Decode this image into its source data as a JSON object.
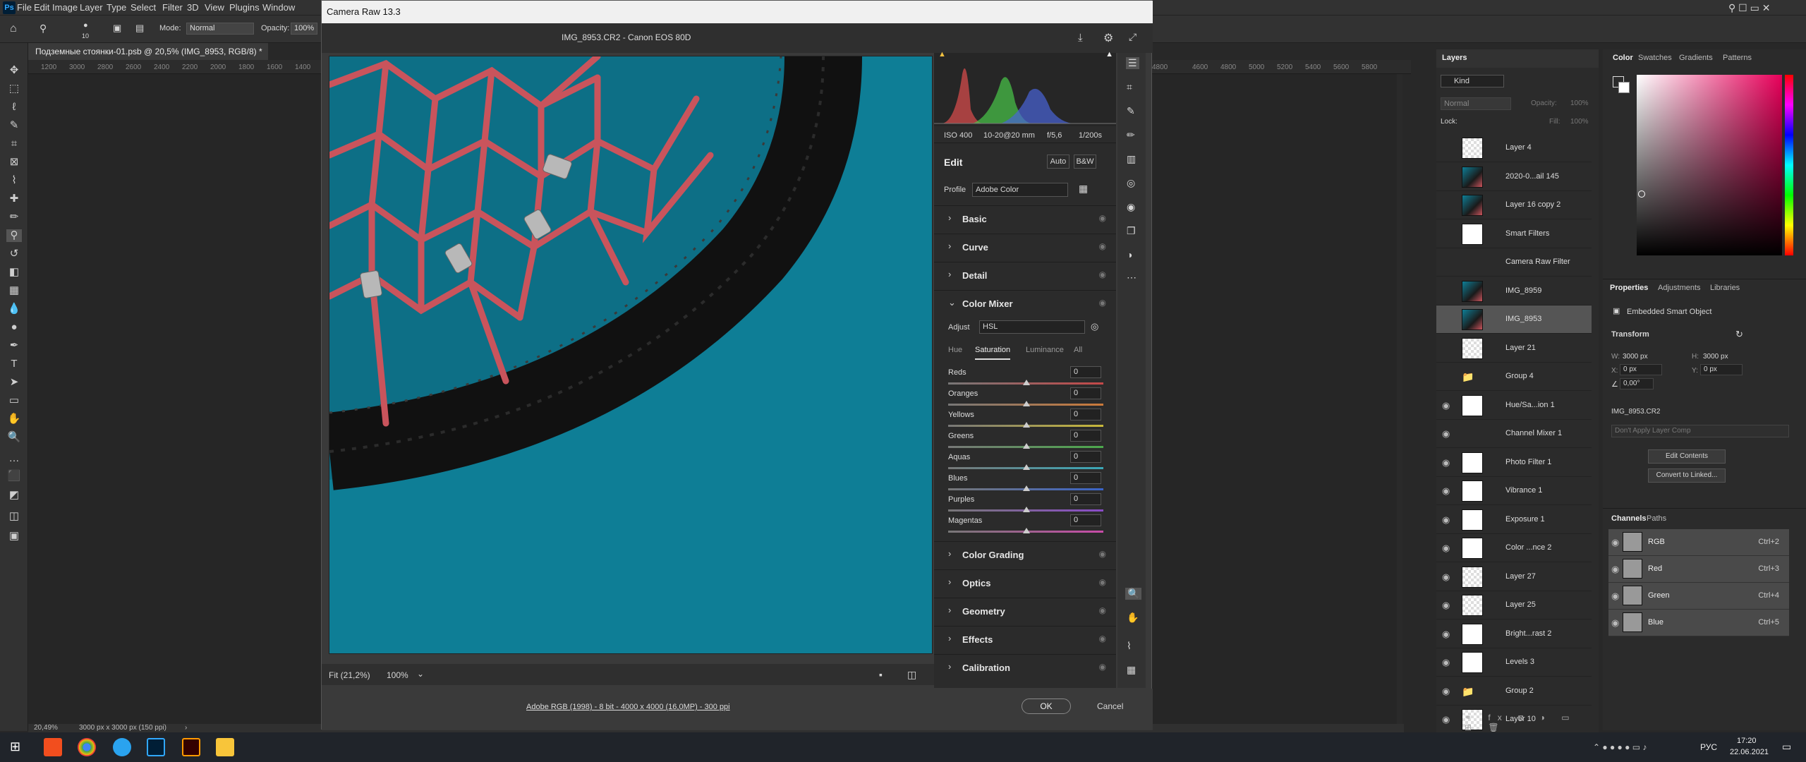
{
  "menu": [
    "File",
    "Edit",
    "Image",
    "Layer",
    "Type",
    "Select",
    "Filter",
    "3D",
    "View",
    "Plugins",
    "Window"
  ],
  "options": {
    "mode_label": "Mode:",
    "mode_value": "Normal",
    "opacity_label": "Opacity:",
    "opacity_value": "100%",
    "brush_size": "10"
  },
  "doc_tab": {
    "title": "Подземные стоянки-01.psb @ 20,5% (IMG_8953, RGB/8) *",
    "close": "×"
  },
  "ruler_left": [
    "1200",
    "3000",
    "2800",
    "2600",
    "2400",
    "2200",
    "2000",
    "1800",
    "1600",
    "1400"
  ],
  "ruler_right": [
    "4800",
    "4600",
    "4800",
    "5000",
    "5200",
    "5400",
    "5600",
    "5800"
  ],
  "status": {
    "zoom": "20,49%",
    "size": "3000 px x 3000 px (150 ppi)"
  },
  "camera_raw": {
    "window_title": "Camera Raw 13.3",
    "file_info": "IMG_8953.CR2  -  Canon EOS 80D",
    "exif": {
      "iso": "ISO 400",
      "lens": "10-20@20 mm",
      "aperture": "f/5,6",
      "shutter": "1/200s"
    },
    "edit_label": "Edit",
    "auto_label": "Auto",
    "bw_label": "B&W",
    "profile_label": "Profile",
    "profile_value": "Adobe Color",
    "sections_top": [
      "Basic",
      "Curve",
      "Detail"
    ],
    "color_mixer": {
      "title": "Color Mixer",
      "adjust_label": "Adjust",
      "adjust_value": "HSL",
      "tabs": [
        "Hue",
        "Saturation",
        "Luminance",
        "All"
      ],
      "active_tab": "Saturation",
      "sliders": [
        {
          "name": "Reds",
          "value": "0",
          "color": "#c44848"
        },
        {
          "name": "Oranges",
          "value": "0",
          "color": "#cc7a3a"
        },
        {
          "name": "Yellows",
          "value": "0",
          "color": "#c8b83a"
        },
        {
          "name": "Greens",
          "value": "0",
          "color": "#4ca84c"
        },
        {
          "name": "Aquas",
          "value": "0",
          "color": "#3aa8b8"
        },
        {
          "name": "Blues",
          "value": "0",
          "color": "#3a64c8"
        },
        {
          "name": "Purples",
          "value": "0",
          "color": "#8a4cc8"
        },
        {
          "name": "Magentas",
          "value": "0",
          "color": "#c84ca8"
        }
      ]
    },
    "sections_bottom": [
      "Color Grading",
      "Optics",
      "Geometry",
      "Effects",
      "Calibration"
    ],
    "fit_label": "Fit (21,2%)",
    "zoom_value": "100%",
    "color_info": "Adobe RGB (1998) - 8 bit - 4000 x 4000 (16,0MP) - 300 ppi",
    "ok_label": "OK",
    "cancel_label": "Cancel"
  },
  "layers": {
    "tabs": [
      "Layers"
    ],
    "kind_label": "Kind",
    "blend_mode": "Normal",
    "opacity_label": "Opacity:",
    "opacity_value": "100%",
    "lock_label": "Lock:",
    "fill_label": "Fill:",
    "fill_value": "100%",
    "rows": [
      {
        "name": "Layer 4",
        "thumb": "checker",
        "selected": false
      },
      {
        "name": "2020-0...ail 145",
        "thumb": "photo",
        "selected": false
      },
      {
        "name": "Layer 16 copy 2",
        "thumb": "photo",
        "selected": false
      },
      {
        "name": "Smart Filters",
        "thumb": "white",
        "selected": false
      },
      {
        "name": "Camera Raw Filter",
        "thumb": "none",
        "selected": false
      },
      {
        "name": "IMG_8959",
        "thumb": "photo",
        "selected": false
      },
      {
        "name": "IMG_8953",
        "thumb": "photo",
        "selected": true
      },
      {
        "name": "Layer 21",
        "thumb": "checker",
        "selected": false
      },
      {
        "name": "Group 4",
        "thumb": "folder",
        "selected": false
      },
      {
        "name": "Hue/Sa...ion 1",
        "thumb": "white",
        "selected": false
      },
      {
        "name": "Channel Mixer 1",
        "thumb": "none",
        "selected": false
      },
      {
        "name": "Photo Filter 1",
        "thumb": "white",
        "selected": false
      },
      {
        "name": "Vibrance 1",
        "thumb": "white",
        "selected": false
      },
      {
        "name": "Exposure 1",
        "thumb": "white",
        "selected": false
      },
      {
        "name": "Color ...nce 2",
        "thumb": "white",
        "selected": false
      },
      {
        "name": "Layer 27",
        "thumb": "checker",
        "selected": false
      },
      {
        "name": "Layer 25",
        "thumb": "checker",
        "selected": false
      },
      {
        "name": "Bright...rast 2",
        "thumb": "white",
        "selected": false
      },
      {
        "name": "Levels 3",
        "thumb": "white",
        "selected": false
      },
      {
        "name": "Group 2",
        "thumb": "folder",
        "selected": false
      },
      {
        "name": "Layer 10",
        "thumb": "checker",
        "selected": false
      }
    ]
  },
  "color_panel": {
    "tabs": [
      "Color",
      "Swatches",
      "Gradients",
      "Patterns"
    ]
  },
  "properties": {
    "tabs": [
      "Properties",
      "Adjustments",
      "Libraries"
    ],
    "type": "Embedded Smart Object",
    "transform_label": "Transform",
    "w_label": "W:",
    "w_value": "3000 px",
    "h_label": "H:",
    "h_value": "3000 px",
    "x_label": "X:",
    "x_value": "0 px",
    "y_label": "Y:",
    "y_value": "0 px",
    "angle_value": "0,00°",
    "file": "IMG_8953.CR2",
    "comp_placeholder": "Don't Apply Layer Comp",
    "edit_contents": "Edit Contents",
    "convert_linked": "Convert to Linked..."
  },
  "channels": {
    "tabs": [
      "Channels",
      "Paths"
    ],
    "rows": [
      {
        "name": "RGB",
        "shortcut": "Ctrl+2"
      },
      {
        "name": "Red",
        "shortcut": "Ctrl+3"
      },
      {
        "name": "Green",
        "shortcut": "Ctrl+4"
      },
      {
        "name": "Blue",
        "shortcut": "Ctrl+5"
      }
    ]
  },
  "taskbar": {
    "lang": "РУС",
    "time": "17:20",
    "date": "22.06.2021"
  }
}
